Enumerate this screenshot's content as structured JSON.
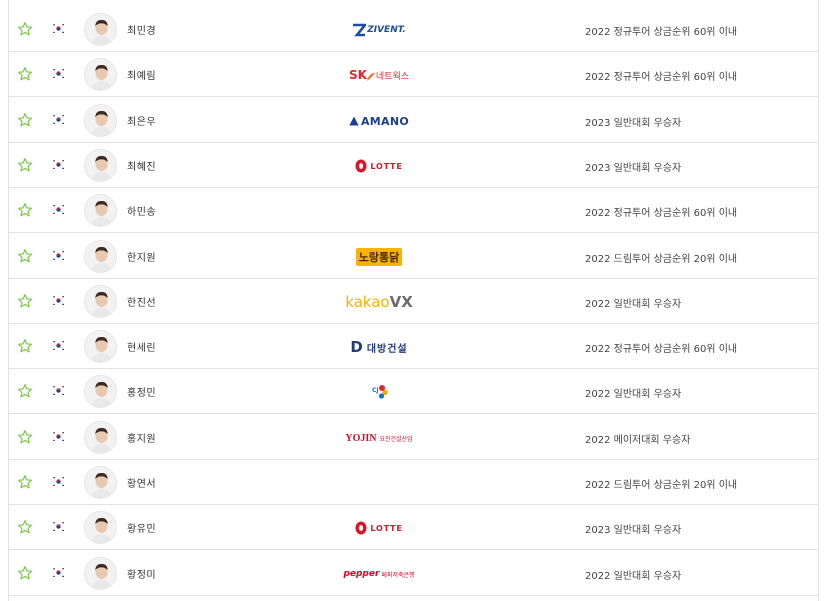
{
  "colors": {
    "border": "#e2e2e2",
    "star": "#7ec94a",
    "lotte_red": "#d8182a",
    "sk_red": "#e3262c",
    "sk_orange": "#f36f21",
    "zivent_blue": "#1b4ea0",
    "amano_blue": "#1d3f8f",
    "kakao_yellow": "#f7b300",
    "kakao_gray": "#6b6b6b",
    "daebang_navy": "#233d7b",
    "yojin_red": "#c8102e",
    "pepper_red": "#e4002b"
  },
  "players": [
    {
      "name": "최민경",
      "sponsor": {
        "type": "zivent",
        "text": "ZIVENT."
      },
      "status": "2022 정규투어 상금순위 60위 이내"
    },
    {
      "name": "최예림",
      "sponsor": {
        "type": "sk",
        "text": "SK",
        "sub": "네트웍스"
      },
      "status": "2022 정규투어 상금순위 60위 이내"
    },
    {
      "name": "최은우",
      "sponsor": {
        "type": "amano",
        "text": "AMANO"
      },
      "status": "2023 일반대회 우승자"
    },
    {
      "name": "최혜진",
      "sponsor": {
        "type": "lotte",
        "text": "LOTTE"
      },
      "status": "2023 일반대회 우승자"
    },
    {
      "name": "하민송",
      "sponsor": {
        "type": "none",
        "text": ""
      },
      "status": "2022 정규투어 상금순위 60위 이내"
    },
    {
      "name": "한지원",
      "sponsor": {
        "type": "nobrand",
        "text": "노랑통닭"
      },
      "status": "2022 드림투어 상금순위 20위 이내"
    },
    {
      "name": "한진선",
      "sponsor": {
        "type": "kakao",
        "text": "kakao",
        "sub": "VX"
      },
      "status": "2022 일반대회 우승자"
    },
    {
      "name": "현세린",
      "sponsor": {
        "type": "daebang",
        "text": "D",
        "sub": "대방건설"
      },
      "status": "2022 정규투어 상금순위 60위 이내"
    },
    {
      "name": "홍정민",
      "sponsor": {
        "type": "cj",
        "text": "CJ"
      },
      "status": "2022 일반대회 우승자"
    },
    {
      "name": "홍지원",
      "sponsor": {
        "type": "yojin",
        "text": "YOJIN",
        "sub": "요진건설산업"
      },
      "status": "2022 메이저대회 우승자"
    },
    {
      "name": "황연서",
      "sponsor": {
        "type": "none",
        "text": ""
      },
      "status": "2022 드림투어 상금순위 20위 이내"
    },
    {
      "name": "황유민",
      "sponsor": {
        "type": "lotte",
        "text": "LOTTE"
      },
      "status": "2023 일반대회 우승자"
    },
    {
      "name": "황정미",
      "sponsor": {
        "type": "pepper",
        "text": "pepper",
        "sub": "페퍼저축은행"
      },
      "status": "2022 일반대회 우승자"
    }
  ]
}
